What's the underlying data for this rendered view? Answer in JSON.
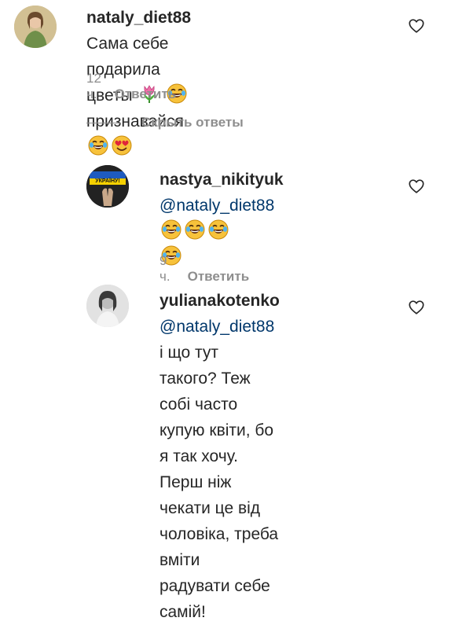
{
  "comments": [
    {
      "username": "nataly_diet88",
      "text_part1": "Сама себе подарила",
      "text_part2": "цветы",
      "text_part3": "признавайся",
      "time": "12 ч.",
      "reply_label": "Ответить",
      "avatar_icon": "avatar-woman-photo"
    },
    {
      "username": "nastya_nikityuk",
      "mention": "@nataly_diet88",
      "time": "9 ч.",
      "reply_label": "Ответить",
      "avatar_icon": "avatar-ukraine-prayer",
      "avatar_text": "УКРАЇНУ!"
    },
    {
      "username": "yulianakotenko",
      "mention": "@nataly_diet88",
      "line1_rest": "і що тут",
      "line2": "такого? Теж собі часто",
      "line3": "купую квіти, бо я так хочу.",
      "line4": "Перш ніж чекати це від",
      "line5": "чоловіка, треба вміти",
      "line6": "радувати себе самій!",
      "avatar_icon": "avatar-woman-bw"
    }
  ],
  "hide_replies_label": "Скрыть ответы",
  "colors": {
    "text": "#262626",
    "muted": "#8e8e8e",
    "mention": "#00376b"
  }
}
